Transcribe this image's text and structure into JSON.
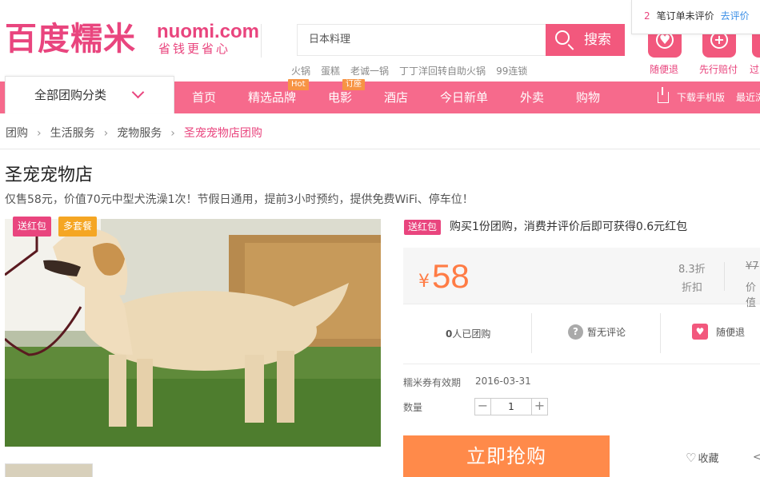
{
  "header": {
    "logo_text": "百度糯米",
    "logo_domain": "nuomi.com",
    "slogan": "省钱更省心",
    "search_value": "日本料理",
    "search_button": "搜索",
    "hot_words": [
      "火锅",
      "蛋糕",
      "老诚一锅",
      "丁丁洋回转自助火锅",
      "99连锁"
    ],
    "promises": [
      {
        "icon": "heart-shield-icon",
        "label": "随便退"
      },
      {
        "icon": "plus-shield-icon",
        "label": "先行赔付"
      },
      {
        "icon": "refund-icon",
        "label": "过"
      }
    ],
    "review_popup": {
      "count": "2",
      "text": "笔订单未评价",
      "link": "去评价"
    }
  },
  "nav": {
    "category_label": "全部团购分类",
    "items": [
      {
        "label": "首页",
        "badge": ""
      },
      {
        "label": "精选品牌",
        "badge": "Hot"
      },
      {
        "label": "电影",
        "badge": "订座"
      },
      {
        "label": "酒店",
        "badge": ""
      },
      {
        "label": "今日新单",
        "badge": ""
      },
      {
        "label": "外卖",
        "badge": ""
      },
      {
        "label": "购物",
        "badge": ""
      }
    ],
    "download": "下载手机版",
    "recent": "最近浏"
  },
  "breadcrumb": [
    "团购",
    "生活服务",
    "宠物服务",
    "圣宠宠物店团购"
  ],
  "deal": {
    "title": "圣宠宠物店",
    "subtitle": "仅售58元，价值70元中型犬洗澡1次！节假日通用，提前3小时预约，提供免费WiFi、停车位！",
    "tags": [
      "送红包",
      "多套餐"
    ],
    "redpacket_tag": "送红包",
    "redpacket_text": "购买1份团购，消费并评价后即可获得0.6元红包",
    "currency": "¥",
    "price": "58",
    "discount_value": "8.3折",
    "discount_label": "折扣",
    "original_value": "¥7",
    "original_label": "价值",
    "stats": {
      "sold": "0",
      "sold_suffix": "人已团购",
      "reviews": "暂无评论",
      "refund": "随便退"
    },
    "validity_label": "糯米券有效期",
    "validity_value": "2016-03-31",
    "quantity_label": "数量",
    "quantity": "1",
    "buy_button": "立即抢购",
    "favorite": "收藏"
  },
  "colors": {
    "brand": "#e9457e",
    "nav": "#f66a8c",
    "price": "#ff7c45",
    "buy": "#ff8a4a"
  }
}
